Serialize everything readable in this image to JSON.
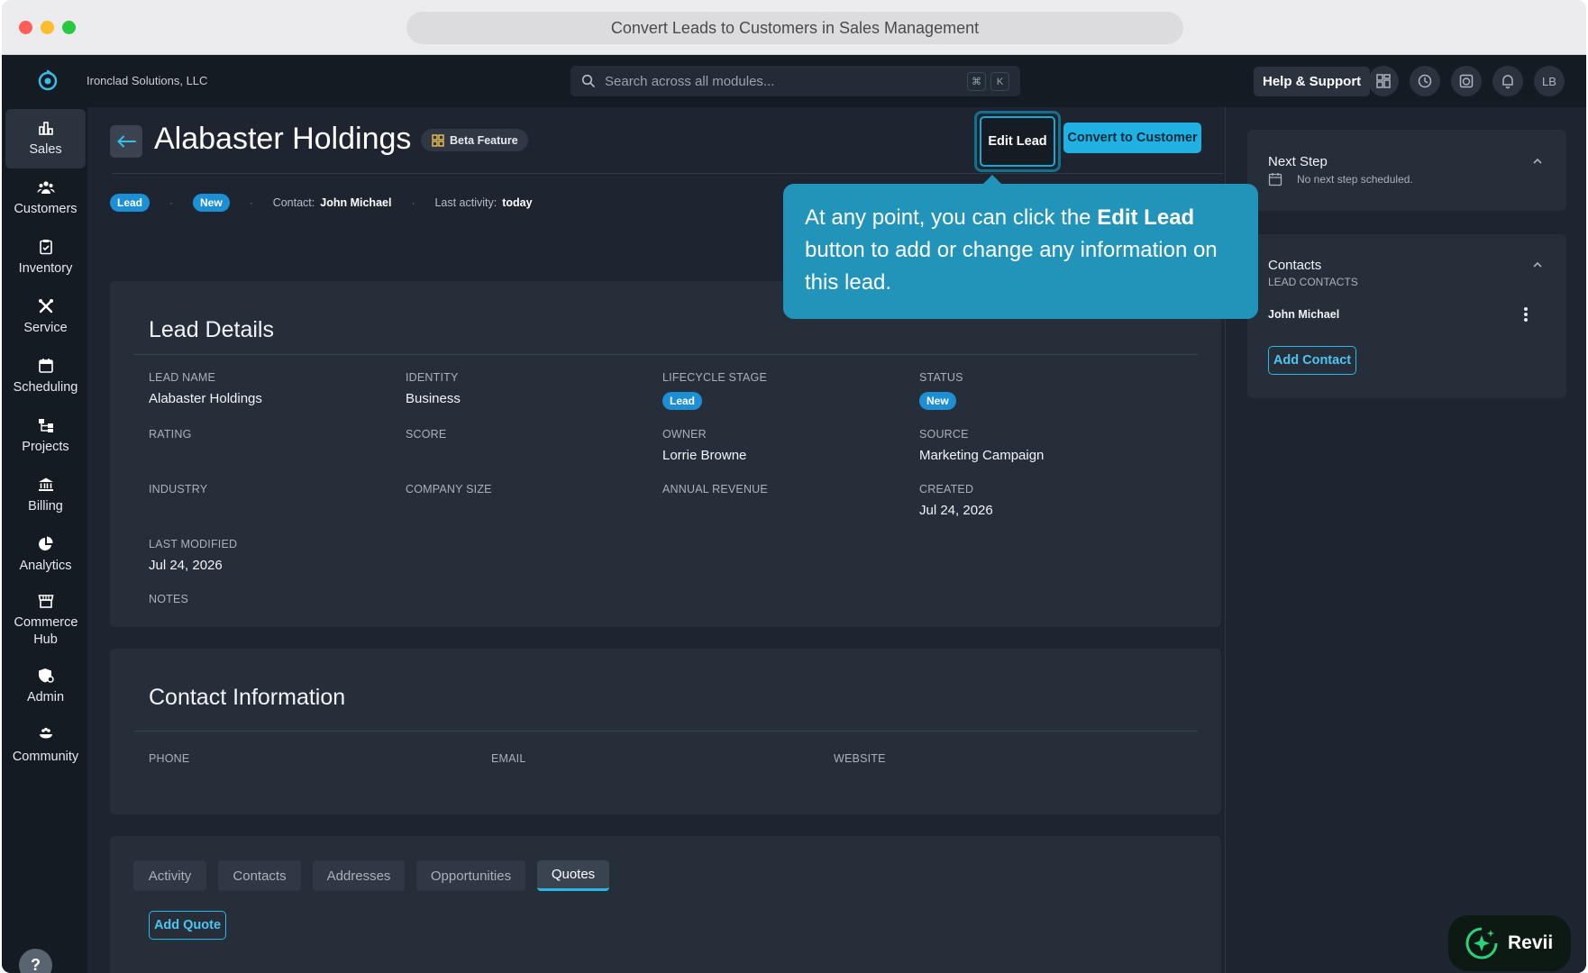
{
  "window": {
    "title": "Convert Leads to Customers in Sales Management"
  },
  "topbar": {
    "company": "Ironclad Solutions, LLC",
    "search_placeholder": "Search across all modules...",
    "kbd_cmd": "⌘",
    "kbd_k": "K",
    "help_label": "Help & Support",
    "avatar": "LB"
  },
  "sidebar": {
    "items": [
      {
        "label": "Sales",
        "icon": "bar-chart-icon"
      },
      {
        "label": "Customers",
        "icon": "people-icon"
      },
      {
        "label": "Inventory",
        "icon": "clipboard-icon"
      },
      {
        "label": "Service",
        "icon": "tools-icon"
      },
      {
        "label": "Scheduling",
        "icon": "calendar-icon"
      },
      {
        "label": "Projects",
        "icon": "hierarchy-icon"
      },
      {
        "label": "Billing",
        "icon": "bank-icon"
      },
      {
        "label": "Analytics",
        "icon": "pie-chart-icon"
      },
      {
        "label": "Commerce Hub",
        "icon": "store-icon"
      },
      {
        "label": "Admin",
        "icon": "admin-shield-icon"
      },
      {
        "label": "Community",
        "icon": "community-icon"
      }
    ],
    "help": "?"
  },
  "header": {
    "title": "Alabaster Holdings",
    "beta": "Beta Feature",
    "edit_label": "Edit Lead",
    "convert_label": "Convert to Customer"
  },
  "meta": {
    "stage_pill": "Lead",
    "status_pill": "New",
    "sep": "·",
    "contact_label": "Contact:",
    "contact_value": "John Michael",
    "activity_label": "Last activity:",
    "activity_value": "today"
  },
  "lead_details": {
    "title": "Lead Details",
    "lead_name_label": "LEAD NAME",
    "lead_name_value": "Alabaster Holdings",
    "identity_label": "IDENTITY",
    "identity_value": "Business",
    "lifecycle_label": "LIFECYCLE STAGE",
    "lifecycle_value": "Lead",
    "status_label": "STATUS",
    "status_value": "New",
    "rating_label": "RATING",
    "score_label": "SCORE",
    "owner_label": "OWNER",
    "owner_value": "Lorrie Browne",
    "source_label": "SOURCE",
    "source_value": "Marketing Campaign",
    "industry_label": "INDUSTRY",
    "company_size_label": "COMPANY SIZE",
    "annual_revenue_label": "ANNUAL REVENUE",
    "created_label": "CREATED",
    "created_value": "Jul 24, 2026",
    "last_modified_label": "LAST MODIFIED",
    "last_modified_value": "Jul 24, 2026",
    "notes_label": "NOTES"
  },
  "contact_info": {
    "title": "Contact Information",
    "phone_label": "PHONE",
    "email_label": "EMAIL",
    "website_label": "WEBSITE"
  },
  "tabs": {
    "items": [
      "Activity",
      "Contacts",
      "Addresses",
      "Opportunities",
      "Quotes"
    ],
    "active": "Quotes",
    "add_quote": "Add Quote"
  },
  "right_panel": {
    "next_step_title": "Next Step",
    "next_step_empty": "No next step scheduled.",
    "contacts_title": "Contacts",
    "contacts_sub": "LEAD CONTACTS",
    "contact_name": "John Michael",
    "add_contact": "Add Contact"
  },
  "tooltip": {
    "text_before": "At any point, you can click the ",
    "text_bold": "Edit Lead",
    "text_after": " button to add or change any information on this lead."
  },
  "assistant": {
    "label": "Revii"
  },
  "colors": {
    "accent": "#20b1e3",
    "pill": "#1d8fd4",
    "tooltip": "#2294b9",
    "bg": "#1e2530",
    "sidebar": "#151b23"
  }
}
